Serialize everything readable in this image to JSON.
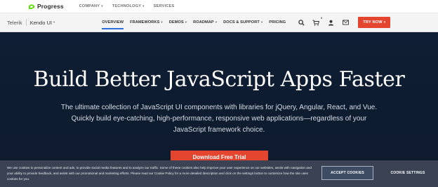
{
  "topbar": {
    "logo_text": "Progress",
    "nav": [
      {
        "label": "COMPANY",
        "has_dropdown": true
      },
      {
        "label": "TECHNOLOGY",
        "has_dropdown": true
      },
      {
        "label": "SERVICES",
        "has_dropdown": false
      }
    ]
  },
  "navbar": {
    "brand": "Telerik",
    "product": "Kendo UI",
    "items": [
      {
        "label": "OVERVIEW",
        "active": true,
        "has_dropdown": false
      },
      {
        "label": "FRAMEWORKS",
        "has_dropdown": true
      },
      {
        "label": "DEMOS",
        "has_dropdown": true
      },
      {
        "label": "ROADMAP",
        "has_dropdown": true
      },
      {
        "label": "DOCS & SUPPORT",
        "has_dropdown": true
      },
      {
        "label": "PRICING",
        "has_dropdown": false
      }
    ],
    "icons": [
      "search-icon",
      "cart-icon",
      "user-icon",
      "mail-icon"
    ],
    "cart_count": "0",
    "cta_label": "TRY NOW",
    "caret": "▾"
  },
  "hero": {
    "title": "Build Better JavaScript Apps Faster",
    "subtitle": "The ultimate collection of JavaScript UI components with libraries for jQuery, Angular, React, and Vue. Quickly build eye-catching, high-performance, responsive web applications—regardless of your JavaScript framework choice.",
    "cta_label": "Download Free Trial"
  },
  "cookie": {
    "text": "We use cookies to personalize content and ads, to provide social media features and to analyze our traffic. Some of these cookies also help improve your user experience on our websites, assist with navigation and your ability to provide feedback, and assist with our promotional and marketing efforts. Please read our Cookie Policy for a more detailed description and click on the settings button to customize how the site uses cookies for you.",
    "accept_label": "ACCEPT COOKIES",
    "settings_label": "COOKIE SETTINGS"
  },
  "colors": {
    "accent": "#e3452f",
    "hero_bg": "#0f1e34",
    "active_underline": "#2a6fdb",
    "progress_green": "#5ce500",
    "cookie_bg": "#3a4254"
  }
}
